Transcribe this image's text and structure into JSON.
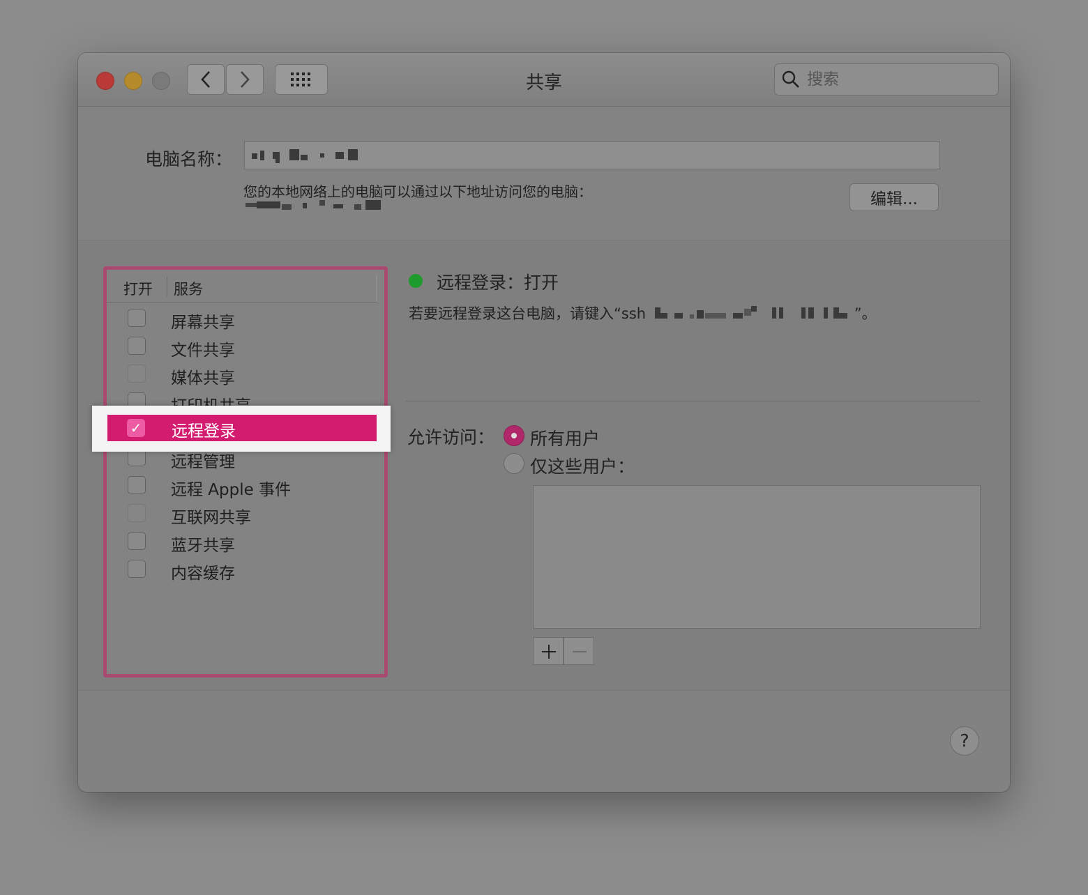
{
  "window": {
    "title": "共享",
    "search_placeholder": "搜索"
  },
  "computer_name": {
    "label": "电脑名称：",
    "local_address_text": "您的本地网络上的电脑可以通过以下地址访问您的电脑：",
    "edit_button": "编辑..."
  },
  "services": {
    "header_on": "打开",
    "header_service": "服务",
    "items": [
      {
        "label": "屏幕共享",
        "checked": false
      },
      {
        "label": "文件共享",
        "checked": false
      },
      {
        "label": "媒体共享",
        "checked": false
      },
      {
        "label": "打印机共享",
        "checked": false
      },
      {
        "label": "远程登录",
        "checked": true
      },
      {
        "label": "远程管理",
        "checked": false
      },
      {
        "label": "远程 Apple 事件",
        "checked": false
      },
      {
        "label": "互联网共享",
        "checked": false
      },
      {
        "label": "蓝牙共享",
        "checked": false
      },
      {
        "label": "内容缓存",
        "checked": false
      }
    ],
    "selected": "远程登录"
  },
  "detail": {
    "status_title": "远程登录：打开",
    "ssh_instruction": "若要远程登录这台电脑，请键入“ssh",
    "ssh_instruction_end": "”。",
    "allow_access_label": "允许访问：",
    "radio_all_users": "所有用户",
    "radio_only_users": "仅这些用户：",
    "selected_radio": "所有用户"
  },
  "colors": {
    "accent": "#d31c6f",
    "status_green": "#1f9a2c",
    "highlight_border": "#a84a72"
  },
  "icons": [
    "back-icon",
    "forward-icon",
    "grid-icon",
    "search-icon",
    "checkmark-icon",
    "plus-icon",
    "minus-icon",
    "help-icon"
  ]
}
